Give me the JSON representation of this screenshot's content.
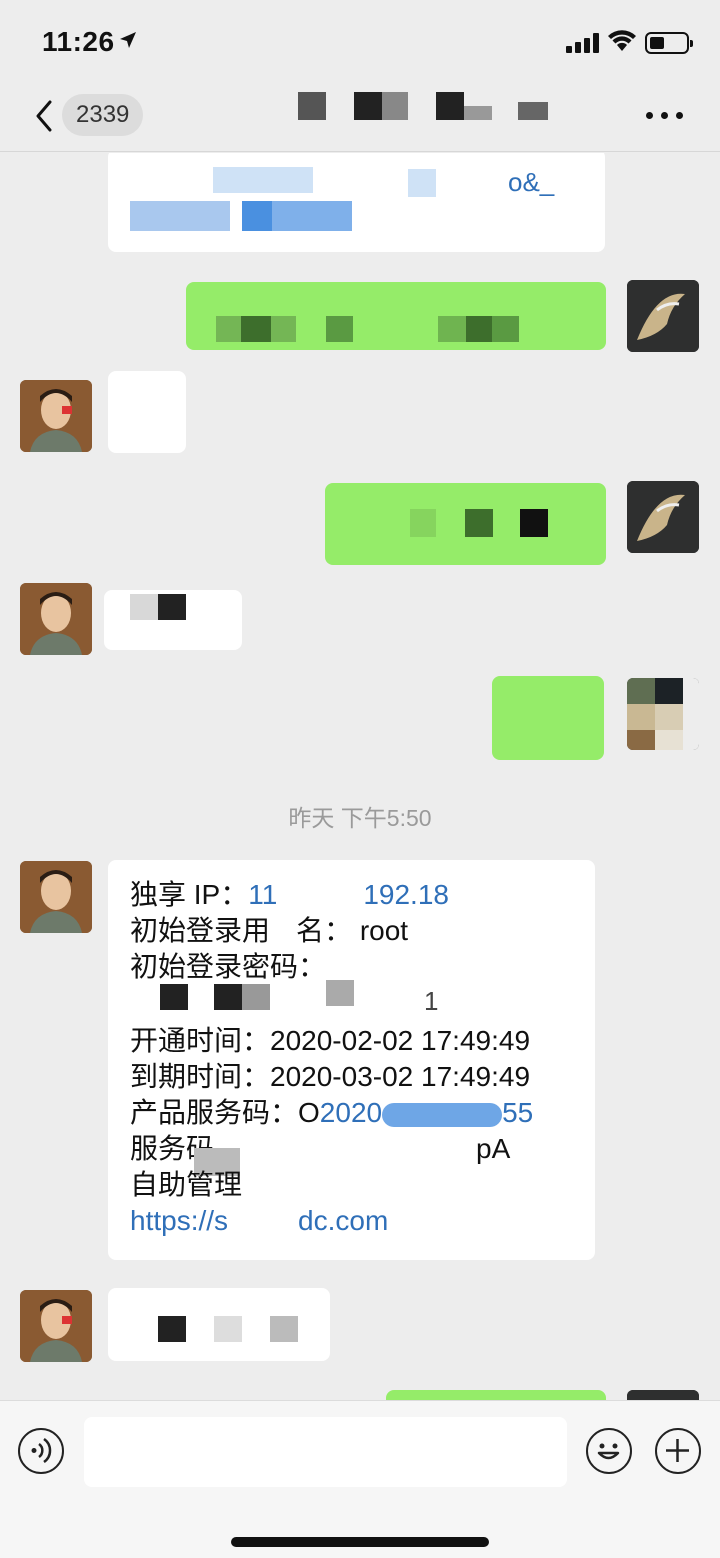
{
  "status_bar": {
    "time": "11:26",
    "location_icon": "location-arrow-icon",
    "signal_icon": "cellular-signal-icon",
    "wifi_icon": "wifi-icon",
    "battery_icon": "battery-icon"
  },
  "nav": {
    "back_icon": "chevron-left-icon",
    "unread_count": "2339",
    "more_icon": "more-dots-icon"
  },
  "timestamp": "昨天 下午5:50",
  "card": {
    "ip_label": "独享 IP：",
    "ip_value_a": "11",
    "ip_value_b": "192.18",
    "user_label": "初始登录用",
    "user_label_b": "名：",
    "user_value": "root",
    "pwd_label": "初始登录密码：",
    "pwd_value_tail": "1",
    "open_label": "开通时间：",
    "open_value": "2020-02-02 17:49:49",
    "expire_label": "到期时间：",
    "expire_value": "2020-03-02 17:49:49",
    "code_label": "产品服务码：",
    "code_value_a": "O",
    "code_value_b": "2020",
    "code_value_c": "55",
    "srv_label": "服务码",
    "srv_value_tail": "pA",
    "self_label": "自助管理",
    "url_a": "https://s",
    "url_b": "dc.com"
  },
  "partial_texts": {
    "first_bubble_tail": "o&_"
  },
  "input_bar": {
    "voice_icon": "voice-icon",
    "emoji_icon": "emoji-icon",
    "plus_icon": "plus-icon"
  },
  "colors": {
    "background": "#ededed",
    "green_bubble": "#95ec69",
    "white_bubble": "#ffffff",
    "link": "#2f6fb8"
  }
}
